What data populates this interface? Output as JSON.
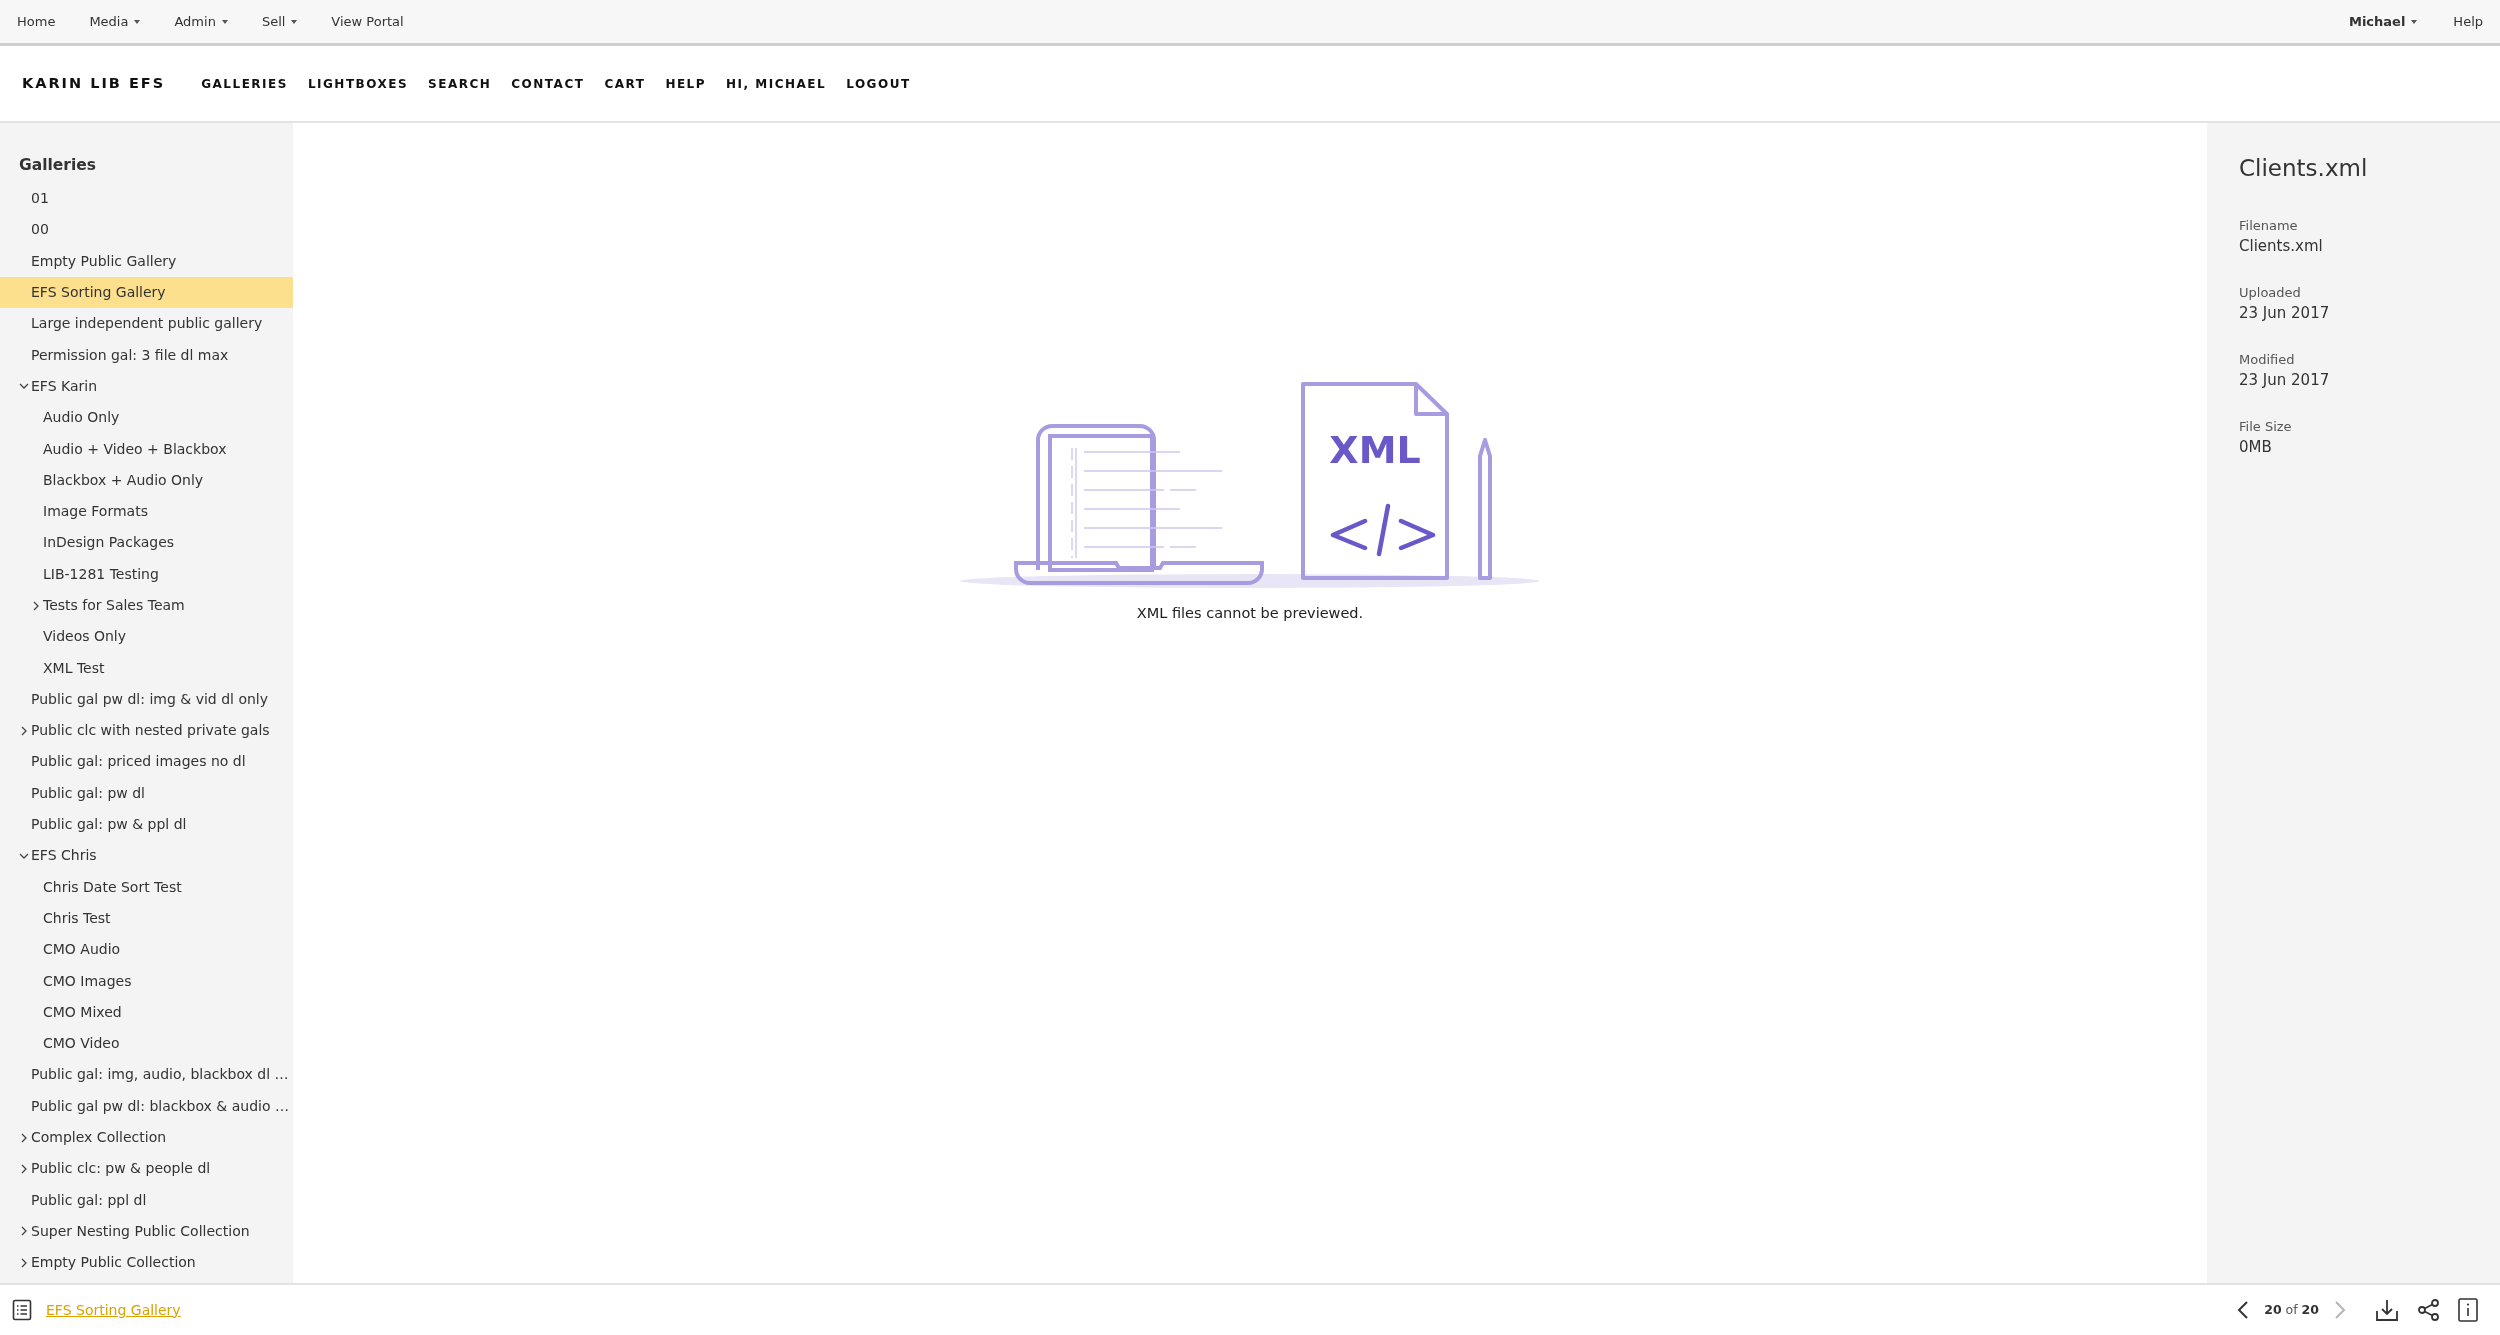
{
  "top_menu": {
    "left": [
      {
        "label": "Home",
        "dropdown": false
      },
      {
        "label": "Media",
        "dropdown": true
      },
      {
        "label": "Admin",
        "dropdown": true
      },
      {
        "label": "Sell",
        "dropdown": true
      },
      {
        "label": "View Portal",
        "dropdown": false
      }
    ],
    "right": [
      {
        "label": "Michael",
        "dropdown": true,
        "bold": true
      },
      {
        "label": "Help",
        "dropdown": false,
        "bold": false
      }
    ]
  },
  "site_header": {
    "brand": "KARIN LIB EFS",
    "nav": [
      "GALLERIES",
      "LIGHTBOXES",
      "SEARCH",
      "CONTACT",
      "CART",
      "HELP",
      "HI, MICHAEL",
      "LOGOUT"
    ]
  },
  "sidebar": {
    "title": "Galleries",
    "items": [
      {
        "label": "01",
        "kind": "gallery",
        "selected": false
      },
      {
        "label": "00",
        "kind": "gallery",
        "selected": false
      },
      {
        "label": "Empty Public Gallery",
        "kind": "gallery",
        "selected": false
      },
      {
        "label": "EFS Sorting Gallery",
        "kind": "gallery",
        "selected": true
      },
      {
        "label": "Large independent public gallery",
        "kind": "gallery",
        "selected": false
      },
      {
        "label": "Permission gal: 3 file dl max",
        "kind": "gallery",
        "selected": false
      },
      {
        "label": "EFS Karin",
        "kind": "collection",
        "expanded": true,
        "selected": false,
        "children": [
          {
            "label": "Audio Only",
            "kind": "gallery",
            "selected": false
          },
          {
            "label": "Audio + Video + Blackbox",
            "kind": "gallery",
            "selected": false
          },
          {
            "label": "Blackbox + Audio Only",
            "kind": "gallery",
            "selected": false
          },
          {
            "label": "Image Formats",
            "kind": "gallery",
            "selected": false
          },
          {
            "label": "InDesign Packages",
            "kind": "gallery",
            "selected": false
          },
          {
            "label": "LIB-1281 Testing",
            "kind": "gallery",
            "selected": false
          },
          {
            "label": "Tests for Sales Team",
            "kind": "collection",
            "expanded": false,
            "selected": false
          },
          {
            "label": "Videos Only",
            "kind": "gallery",
            "selected": false
          },
          {
            "label": "XML Test",
            "kind": "gallery",
            "selected": false
          }
        ]
      },
      {
        "label": "Public gal pw dl: img & vid dl only",
        "kind": "gallery",
        "selected": false
      },
      {
        "label": "Public clc with nested private gals",
        "kind": "collection",
        "expanded": false,
        "selected": false
      },
      {
        "label": "Public gal: priced images no dl",
        "kind": "gallery",
        "selected": false
      },
      {
        "label": "Public gal: pw dl",
        "kind": "gallery",
        "selected": false
      },
      {
        "label": "Public gal: pw & ppl dl",
        "kind": "gallery",
        "selected": false
      },
      {
        "label": "EFS Chris",
        "kind": "collection",
        "expanded": true,
        "selected": false,
        "children": [
          {
            "label": "Chris Date Sort Test",
            "kind": "gallery",
            "selected": false
          },
          {
            "label": "Chris Test",
            "kind": "gallery",
            "selected": false
          },
          {
            "label": "CMO Audio",
            "kind": "gallery",
            "selected": false
          },
          {
            "label": "CMO Images",
            "kind": "gallery",
            "selected": false
          },
          {
            "label": "CMO Mixed",
            "kind": "gallery",
            "selected": false
          },
          {
            "label": "CMO Video",
            "kind": "gallery",
            "selected": false
          }
        ]
      },
      {
        "label": "Public gal: img, audio, blackbox dl …",
        "kind": "gallery",
        "selected": false
      },
      {
        "label": "Public gal pw dl: blackbox & audio …",
        "kind": "gallery",
        "selected": false
      },
      {
        "label": "Complex Collection",
        "kind": "collection",
        "expanded": false,
        "selected": false
      },
      {
        "label": "Public clc: pw & people dl",
        "kind": "collection",
        "expanded": false,
        "selected": false
      },
      {
        "label": "Public gal: ppl dl",
        "kind": "gallery",
        "selected": false
      },
      {
        "label": "Super Nesting Public Collection",
        "kind": "collection",
        "expanded": false,
        "selected": false
      },
      {
        "label": "Empty Public Collection",
        "kind": "collection",
        "expanded": false,
        "selected": false
      }
    ]
  },
  "preview": {
    "file_badge": "XML",
    "message": "XML files cannot be previewed."
  },
  "details": {
    "title": "Clients.xml",
    "fields": [
      {
        "label": "Filename",
        "value": "Clients.xml"
      },
      {
        "label": "Uploaded",
        "value": "23 Jun 2017"
      },
      {
        "label": "Modified",
        "value": "23 Jun 2017"
      },
      {
        "label": "File Size",
        "value": "0MB"
      }
    ]
  },
  "footer": {
    "gallery_link": "EFS Sorting Gallery",
    "counter": "**20** of **20**",
    "prev_disabled": false,
    "next_disabled": true
  }
}
